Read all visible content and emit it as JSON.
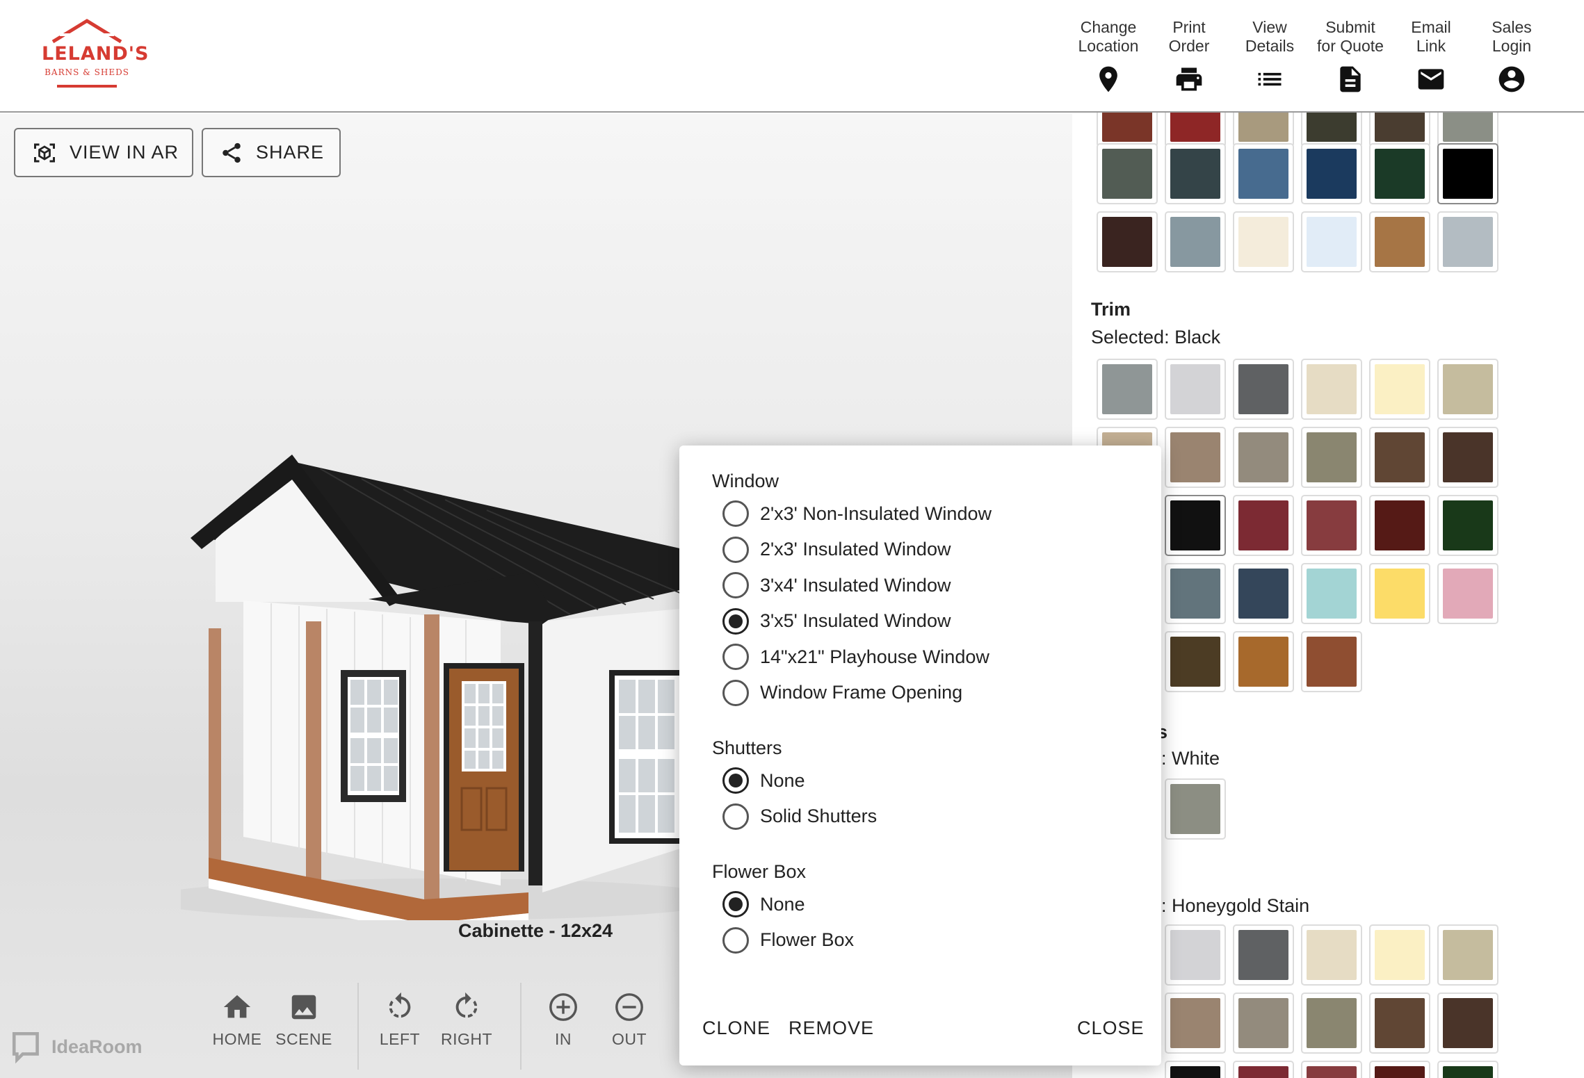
{
  "header": {
    "logo_title": "LELAND'S",
    "logo_subtitle": "BARNS & SHEDS",
    "nav": [
      {
        "label": "Change\nLocation",
        "icon": "location-pin-icon"
      },
      {
        "label": "Print\nOrder",
        "icon": "printer-icon"
      },
      {
        "label": "View\nDetails",
        "icon": "list-icon"
      },
      {
        "label": "Submit\nfor Quote",
        "icon": "document-icon"
      },
      {
        "label": "Email\nLink",
        "icon": "envelope-icon"
      },
      {
        "label": "Sales\nLogin",
        "icon": "account-icon"
      }
    ]
  },
  "viewer": {
    "view_in_ar": "VIEW IN AR",
    "share": "SHARE",
    "product_name": "Cabinette - 12x24",
    "controls": [
      {
        "label": "HOME",
        "icon": "home-icon"
      },
      {
        "label": "SCENE",
        "icon": "image-icon"
      },
      {
        "label": "LEFT",
        "icon": "rotate-left-icon"
      },
      {
        "label": "RIGHT",
        "icon": "rotate-right-icon"
      },
      {
        "label": "IN",
        "icon": "zoom-in-icon"
      },
      {
        "label": "OUT",
        "icon": "zoom-out-icon"
      }
    ],
    "brand": "IdeaRoom"
  },
  "panel": {
    "trim_title": "Trim",
    "trim_selected": "Selected: Black",
    "section3_title_fragment": "s",
    "section3_selected_fragment": "l: White",
    "section4_selected_fragment": "l: Honeygold Stain",
    "colors": {
      "top_partial": [
        "#7a3528",
        "#8e2626",
        "#a89a7e",
        "#3c3c2f",
        "#4a3d30",
        "#8b8f86"
      ],
      "top_row1": [
        "#525c54",
        "#344448",
        "#476b8f",
        "#1b3a5e",
        "#1b3a27",
        "#000000"
      ],
      "top_row2": [
        "#3a2420",
        "#8798a0",
        "#f4ecdb",
        "#e1ecf7",
        "#a67545",
        "#b3bcc2"
      ],
      "trim_row1": [
        "#8f9696",
        "#d3d3d6",
        "#5f6163",
        "#e6dcc4",
        "#fbf0c4",
        "#c5bc9e"
      ],
      "trim_row2": [
        "#c4b094",
        "#9a8470",
        "#938b7d",
        "#8a8670",
        "#604634",
        "#4a3429"
      ],
      "trim_row3": [
        "#111111",
        "#7c2a33",
        "#873c3f",
        "#551a16",
        "#193919"
      ],
      "trim_row4": [
        "#62747c",
        "#34465a",
        "#a3d4d4",
        "#fcdc68",
        "#e2a9b8"
      ],
      "trim_row5": [
        "#4c3c24",
        "#a7692c",
        "#8f4e31"
      ],
      "sec3_row1": [
        "#8c8e83"
      ],
      "sec4_row1": [
        "#d3d3d6",
        "#5f6163",
        "#e6dcc4",
        "#fbf0c4",
        "#c5bc9e"
      ],
      "sec4_row2": [
        "#9a8470",
        "#938b7d",
        "#8a8670",
        "#604634",
        "#4a3429"
      ],
      "sec4_row3_partial": [
        "#111111",
        "#7c2a33",
        "#873c3f",
        "#551a16",
        "#193919"
      ]
    }
  },
  "popup": {
    "window_title": "Window",
    "window_options": [
      "2'x3' Non-Insulated Window",
      "2'x3' Insulated Window",
      "3'x4' Insulated Window",
      "3'x5' Insulated Window",
      "14\"x21\" Playhouse Window",
      "Window Frame Opening"
    ],
    "window_selected": 3,
    "shutters_title": "Shutters",
    "shutters_options": [
      "None",
      "Solid Shutters"
    ],
    "shutters_selected": 0,
    "flowerbox_title": "Flower Box",
    "flowerbox_options": [
      "None",
      "Flower Box"
    ],
    "flowerbox_selected": 0,
    "clone": "CLONE",
    "remove": "REMOVE",
    "close": "CLOSE"
  }
}
